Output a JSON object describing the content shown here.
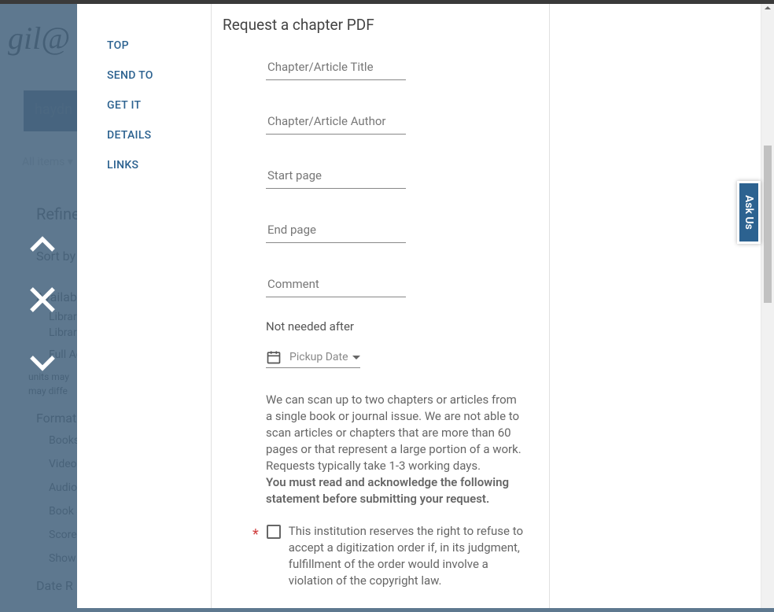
{
  "background": {
    "logo_text": "gil@",
    "search_value": "haydn",
    "filter_label": "All items ▾",
    "refine_heading": "Refine",
    "sort_by": "Sort by",
    "avail_heading": "Availability",
    "avail_lib": "Library",
    "avail_full": "Full Access",
    "avail_note1": "units may",
    "avail_note2": "may diffe",
    "format_heading": "Formats",
    "format_books": "Books",
    "format_video": "Video",
    "format_audio": "Audio",
    "format_book_s": "Book S",
    "format_scores": "Scores",
    "format_show": "Show",
    "date_heading": "Date R"
  },
  "sidebar_nav": {
    "items": [
      {
        "label": "TOP"
      },
      {
        "label": "SEND TO"
      },
      {
        "label": "GET IT"
      },
      {
        "label": "DETAILS"
      },
      {
        "label": "LINKS"
      }
    ]
  },
  "form": {
    "heading": "Request a chapter PDF",
    "fields": {
      "chapter_title": "Chapter/Article Title",
      "chapter_author": "Chapter/Article Author",
      "start_page": "Start page",
      "end_page": "End page",
      "comment": "Comment"
    },
    "not_needed_after": "Not needed after",
    "pickup_date": "Pickup Date",
    "info_text": "We can scan up to two chapters or articles from a single book or journal issue. We are not able to scan articles or chapters that are more than 60 pages or that represent a large portion of a work. Requests typically take 1-3 working days.",
    "info_bold": "You must read and acknowledge the following statement before submitting your request.",
    "ack_text": "This institution reserves the right to refuse to accept a digitization order if, in its judgment, fulfillment of the order would involve a violation of the copyright law."
  },
  "ask_us": "Ask Us"
}
